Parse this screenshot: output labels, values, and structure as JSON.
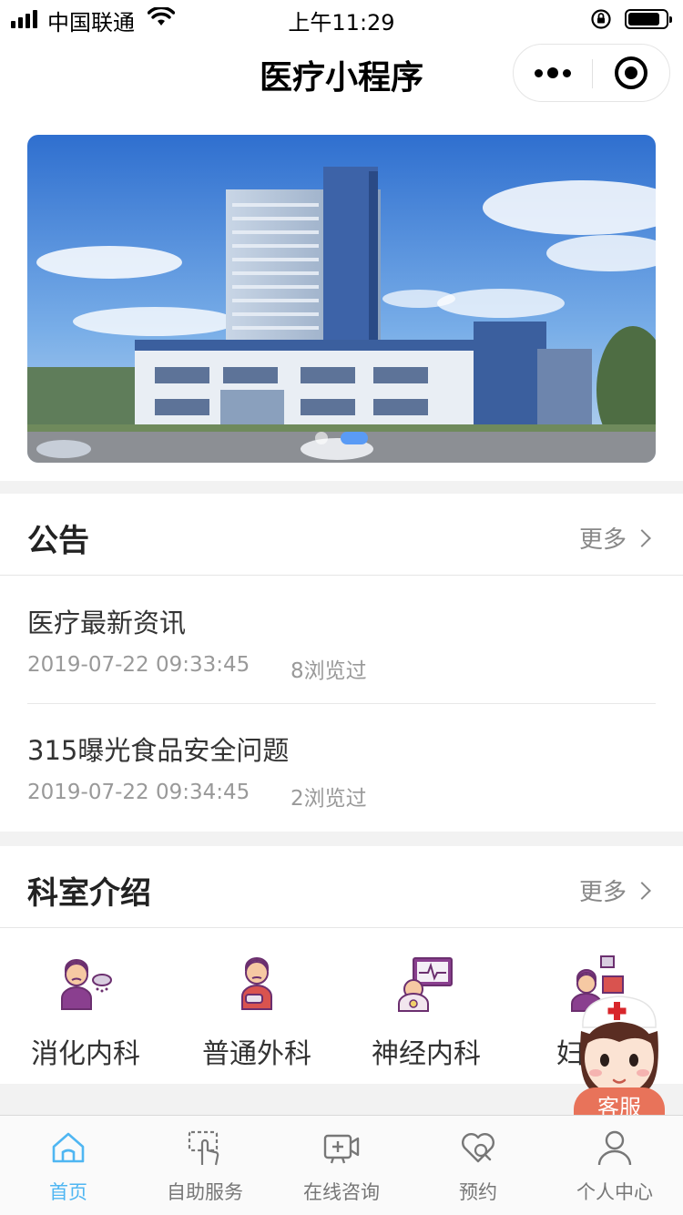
{
  "status_bar": {
    "carrier": "中国联通",
    "time": "上午11:29",
    "battery_level": 0.85
  },
  "nav": {
    "title": "医疗小程序"
  },
  "banner": {
    "slide_count": 2,
    "active_slide": 2
  },
  "notice": {
    "title": "公告",
    "more": "更多",
    "items": [
      {
        "title": "医疗最新资讯",
        "time": "2019-07-22 09:33:45",
        "views": "8浏览过"
      },
      {
        "title": "315曝光食品安全问题",
        "time": "2019-07-22 09:34:45",
        "views": "2浏览过"
      }
    ]
  },
  "departments": {
    "title": "科室介绍",
    "more": "更多",
    "items": [
      {
        "label": "消化内科",
        "icon": "digestive-icon"
      },
      {
        "label": "普通外科",
        "icon": "surgery-icon"
      },
      {
        "label": "神经内科",
        "icon": "neurology-icon"
      },
      {
        "label": "妇产科",
        "icon": "gynecology-icon"
      }
    ]
  },
  "service": {
    "label": "客服"
  },
  "tabbar": {
    "items": [
      {
        "label": "首页",
        "icon": "home-icon",
        "active": true
      },
      {
        "label": "自助服务",
        "icon": "self-service-icon",
        "active": false
      },
      {
        "label": "在线咨询",
        "icon": "video-consult-icon",
        "active": false
      },
      {
        "label": "预约",
        "icon": "appointment-heart-icon",
        "active": false
      },
      {
        "label": "个人中心",
        "icon": "user-icon",
        "active": false
      }
    ]
  },
  "colors": {
    "accent": "#4fb6f2",
    "dept_icon_purple": "#6b2f6f",
    "service_badge": "#e8735a"
  }
}
